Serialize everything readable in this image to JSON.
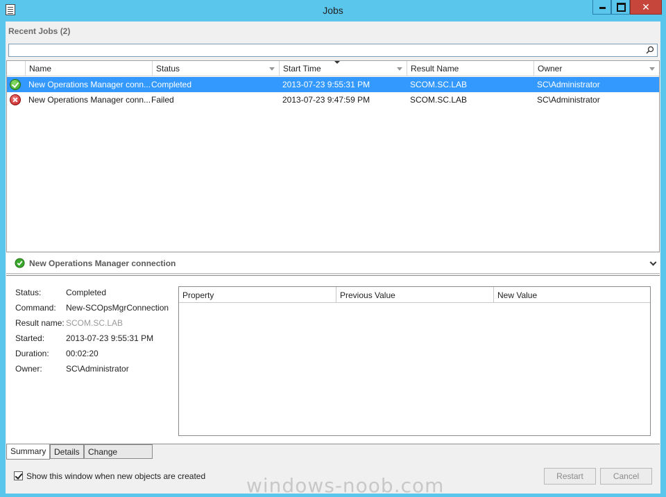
{
  "window": {
    "title": "Jobs",
    "close_glyph": "✕"
  },
  "recent_jobs_label": "Recent Jobs (2)",
  "search": {
    "value": "",
    "placeholder": ""
  },
  "grid": {
    "columns": [
      "Name",
      "Status",
      "Start Time",
      "Result Name",
      "Owner"
    ],
    "rows": [
      {
        "icon": "success-check-icon",
        "name": "New Operations Manager conn...",
        "status": "Completed",
        "start_time": "2013-07-23 9:55:31 PM",
        "result_name": "SCOM.SC.LAB",
        "owner": "SC\\Administrator",
        "selected": true
      },
      {
        "icon": "error-x-icon",
        "name": "New Operations Manager conn...",
        "status": "Failed",
        "start_time": "2013-07-23 9:47:59 PM",
        "result_name": "SCOM.SC.LAB",
        "owner": "SC\\Administrator",
        "selected": false
      }
    ]
  },
  "detail": {
    "header_title": "New Operations Manager connection",
    "fields": [
      {
        "label": "Status:",
        "value": "Completed"
      },
      {
        "label": "Command:",
        "value": "New-SCOpsMgrConnection"
      },
      {
        "label": "Result name:",
        "value": "SCOM.SC.LAB"
      },
      {
        "label": "Started:",
        "value": "2013-07-23 9:55:31 PM"
      },
      {
        "label": "Duration:",
        "value": "00:02:20"
      },
      {
        "label": "Owner:",
        "value": "SC\\Administrator"
      }
    ],
    "property_columns": [
      "Property",
      "Previous Value",
      "New Value"
    ]
  },
  "tabs": [
    "Summary",
    "Details",
    "Change Tracking"
  ],
  "show_window_checkbox": {
    "label": "Show this window when new objects are created",
    "checked": true
  },
  "buttons": {
    "restart": "Restart",
    "cancel": "Cancel"
  },
  "watermark": "windows-noob.com",
  "colors": {
    "titlebar": "#5bc6ec",
    "selection": "#3399ff",
    "close_button": "#c7463c"
  }
}
